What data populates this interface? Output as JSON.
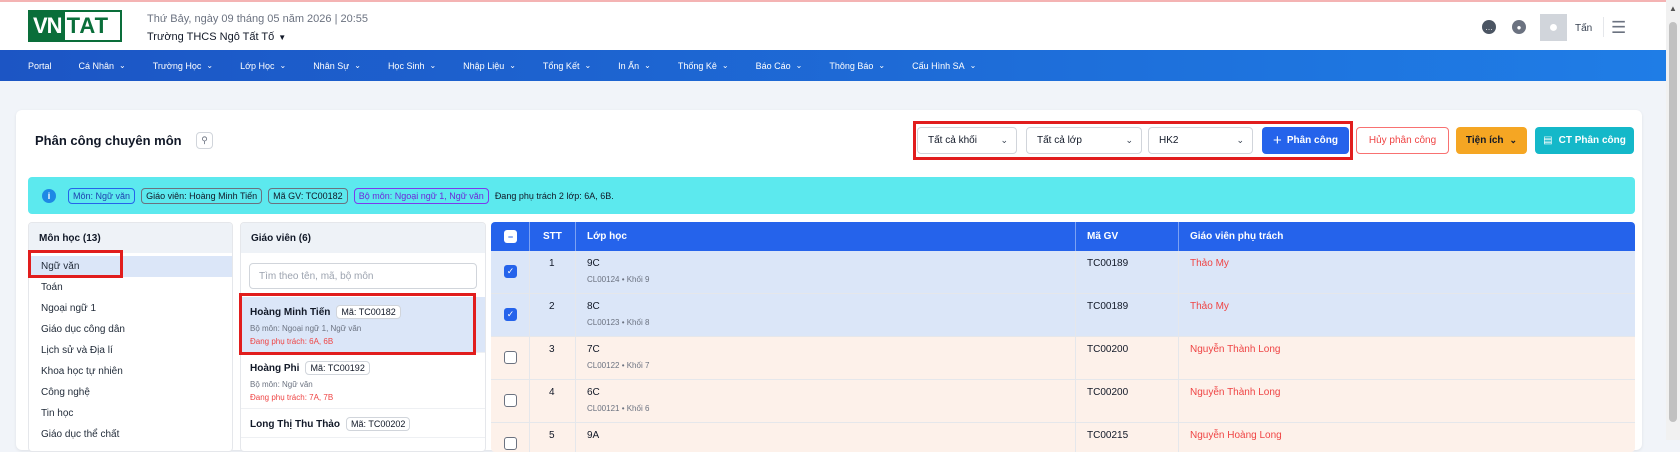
{
  "header": {
    "logo_vn": "VN",
    "logo_rest": "TAT",
    "date": "Thứ Bảy, ngày 09 tháng 05 năm 2026 | 20:55",
    "school": "Trường THCS Ngô Tất Tố",
    "user": "Tấn"
  },
  "nav": [
    {
      "label": "Portal",
      "has_menu": false
    },
    {
      "label": "Cá Nhân",
      "has_menu": true
    },
    {
      "label": "Trường Học",
      "has_menu": true
    },
    {
      "label": "Lớp Học",
      "has_menu": true
    },
    {
      "label": "Nhân Sự",
      "has_menu": true
    },
    {
      "label": "Học Sinh",
      "has_menu": true
    },
    {
      "label": "Nhập Liệu",
      "has_menu": true
    },
    {
      "label": "Tổng Kết",
      "has_menu": true
    },
    {
      "label": "In Ấn",
      "has_menu": true
    },
    {
      "label": "Thống Kê",
      "has_menu": true
    },
    {
      "label": "Báo Cáo",
      "has_menu": true
    },
    {
      "label": "Thông Báo",
      "has_menu": true
    },
    {
      "label": "Cấu Hình SA",
      "has_menu": true
    }
  ],
  "page": {
    "title": "Phân công chuyên môn",
    "filter_grade": "Tất cả khối",
    "filter_class": "Tất cả lớp",
    "filter_term": "HK2",
    "assign_button": "Phân công",
    "cancel_button": "Hủy phân công",
    "utility_button": "Tiện ích",
    "detail_button": "CT Phân công"
  },
  "info_bar": {
    "subject_tag": "Môn: Ngữ văn",
    "teacher_tag": "Giáo viên: Hoàng Minh Tiến",
    "code_tag": "Mã GV: TC00182",
    "dept_tag": "Bộ môn: Ngoại ngữ 1, Ngữ văn",
    "text": "Đang phụ trách 2 lớp: 6A, 6B."
  },
  "subjects": {
    "header": "Môn học (13)",
    "items": [
      "Ngữ văn",
      "Toán",
      "Ngoại ngữ 1",
      "Giáo dục công dân",
      "Lịch sử và Địa lí",
      "Khoa học tự nhiên",
      "Công nghệ",
      "Tin học",
      "Giáo dục thể chất"
    ],
    "selected": 0
  },
  "teachers": {
    "header": "Giáo viên (6)",
    "search_placeholder": "Tìm theo tên, mã, bộ môn",
    "items": [
      {
        "name": "Hoàng Minh Tiến",
        "code": "Mã: TC00182",
        "dept": "Bộ môn: Ngoại ngữ 1, Ngữ văn",
        "load": "Đang phụ trách: 6A, 6B"
      },
      {
        "name": "Hoàng Phi",
        "code": "Mã: TC00192",
        "dept": "Bộ môn: Ngữ văn",
        "load": "Đang phụ trách: 7A, 7B"
      },
      {
        "name": "Long Thị Thu Thảo",
        "code": "Mã: TC00202",
        "dept": "",
        "load": ""
      }
    ]
  },
  "table": {
    "headers": {
      "stt": "STT",
      "class": "Lớp học",
      "code": "Mã GV",
      "teacher": "Giáo viên phụ trách"
    },
    "rows": [
      {
        "checked": true,
        "stt": "1",
        "class": "9C",
        "meta": "CL00124 • Khối 9",
        "code": "TC00189",
        "teacher": "Thảo My"
      },
      {
        "checked": true,
        "stt": "2",
        "class": "8C",
        "meta": "CL00123 • Khối 8",
        "code": "TC00189",
        "teacher": "Thảo My"
      },
      {
        "checked": false,
        "stt": "3",
        "class": "7C",
        "meta": "CL00122 • Khối 7",
        "code": "TC00200",
        "teacher": "Nguyễn Thành Long"
      },
      {
        "checked": false,
        "stt": "4",
        "class": "6C",
        "meta": "CL00121 • Khối 6",
        "code": "TC00200",
        "teacher": "Nguyễn Thành Long"
      },
      {
        "checked": false,
        "stt": "5",
        "class": "9A",
        "meta": "",
        "code": "TC00215",
        "teacher": "Nguyễn Hoàng Long"
      }
    ]
  },
  "colors": {
    "primary": "#2563eb",
    "accent_cyan": "#5ce9ee",
    "warn": "#f59e0b",
    "danger": "#ef4444",
    "highlight": "#e11d1d"
  }
}
